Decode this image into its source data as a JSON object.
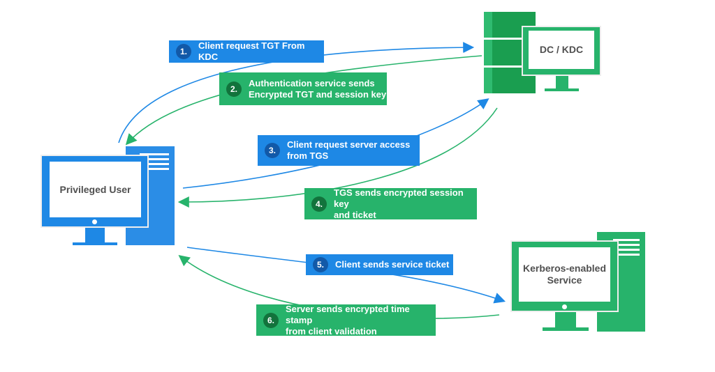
{
  "colors": {
    "blue": "#1e88e5",
    "green": "#27b36b",
    "dark_green": "#1a9e50"
  },
  "nodes": {
    "client": "Privileged User",
    "kdc": "DC / KDC",
    "service_line1": "Kerberos-enabled",
    "service_line2": "Service"
  },
  "steps": [
    {
      "num": "1.",
      "line1": "Client request TGT From KDC",
      "line2": ""
    },
    {
      "num": "2.",
      "line1": "Authentication service sends",
      "line2": "Encrypted TGT and session key"
    },
    {
      "num": "3.",
      "line1": "Client request server access",
      "line2": "from TGS"
    },
    {
      "num": "4.",
      "line1": "TGS sends encrypted session key",
      "line2": "and ticket"
    },
    {
      "num": "5.",
      "line1": "Client sends service ticket",
      "line2": ""
    },
    {
      "num": "6.",
      "line1": "Server sends encrypted time stamp",
      "line2": "from client validation"
    }
  ]
}
